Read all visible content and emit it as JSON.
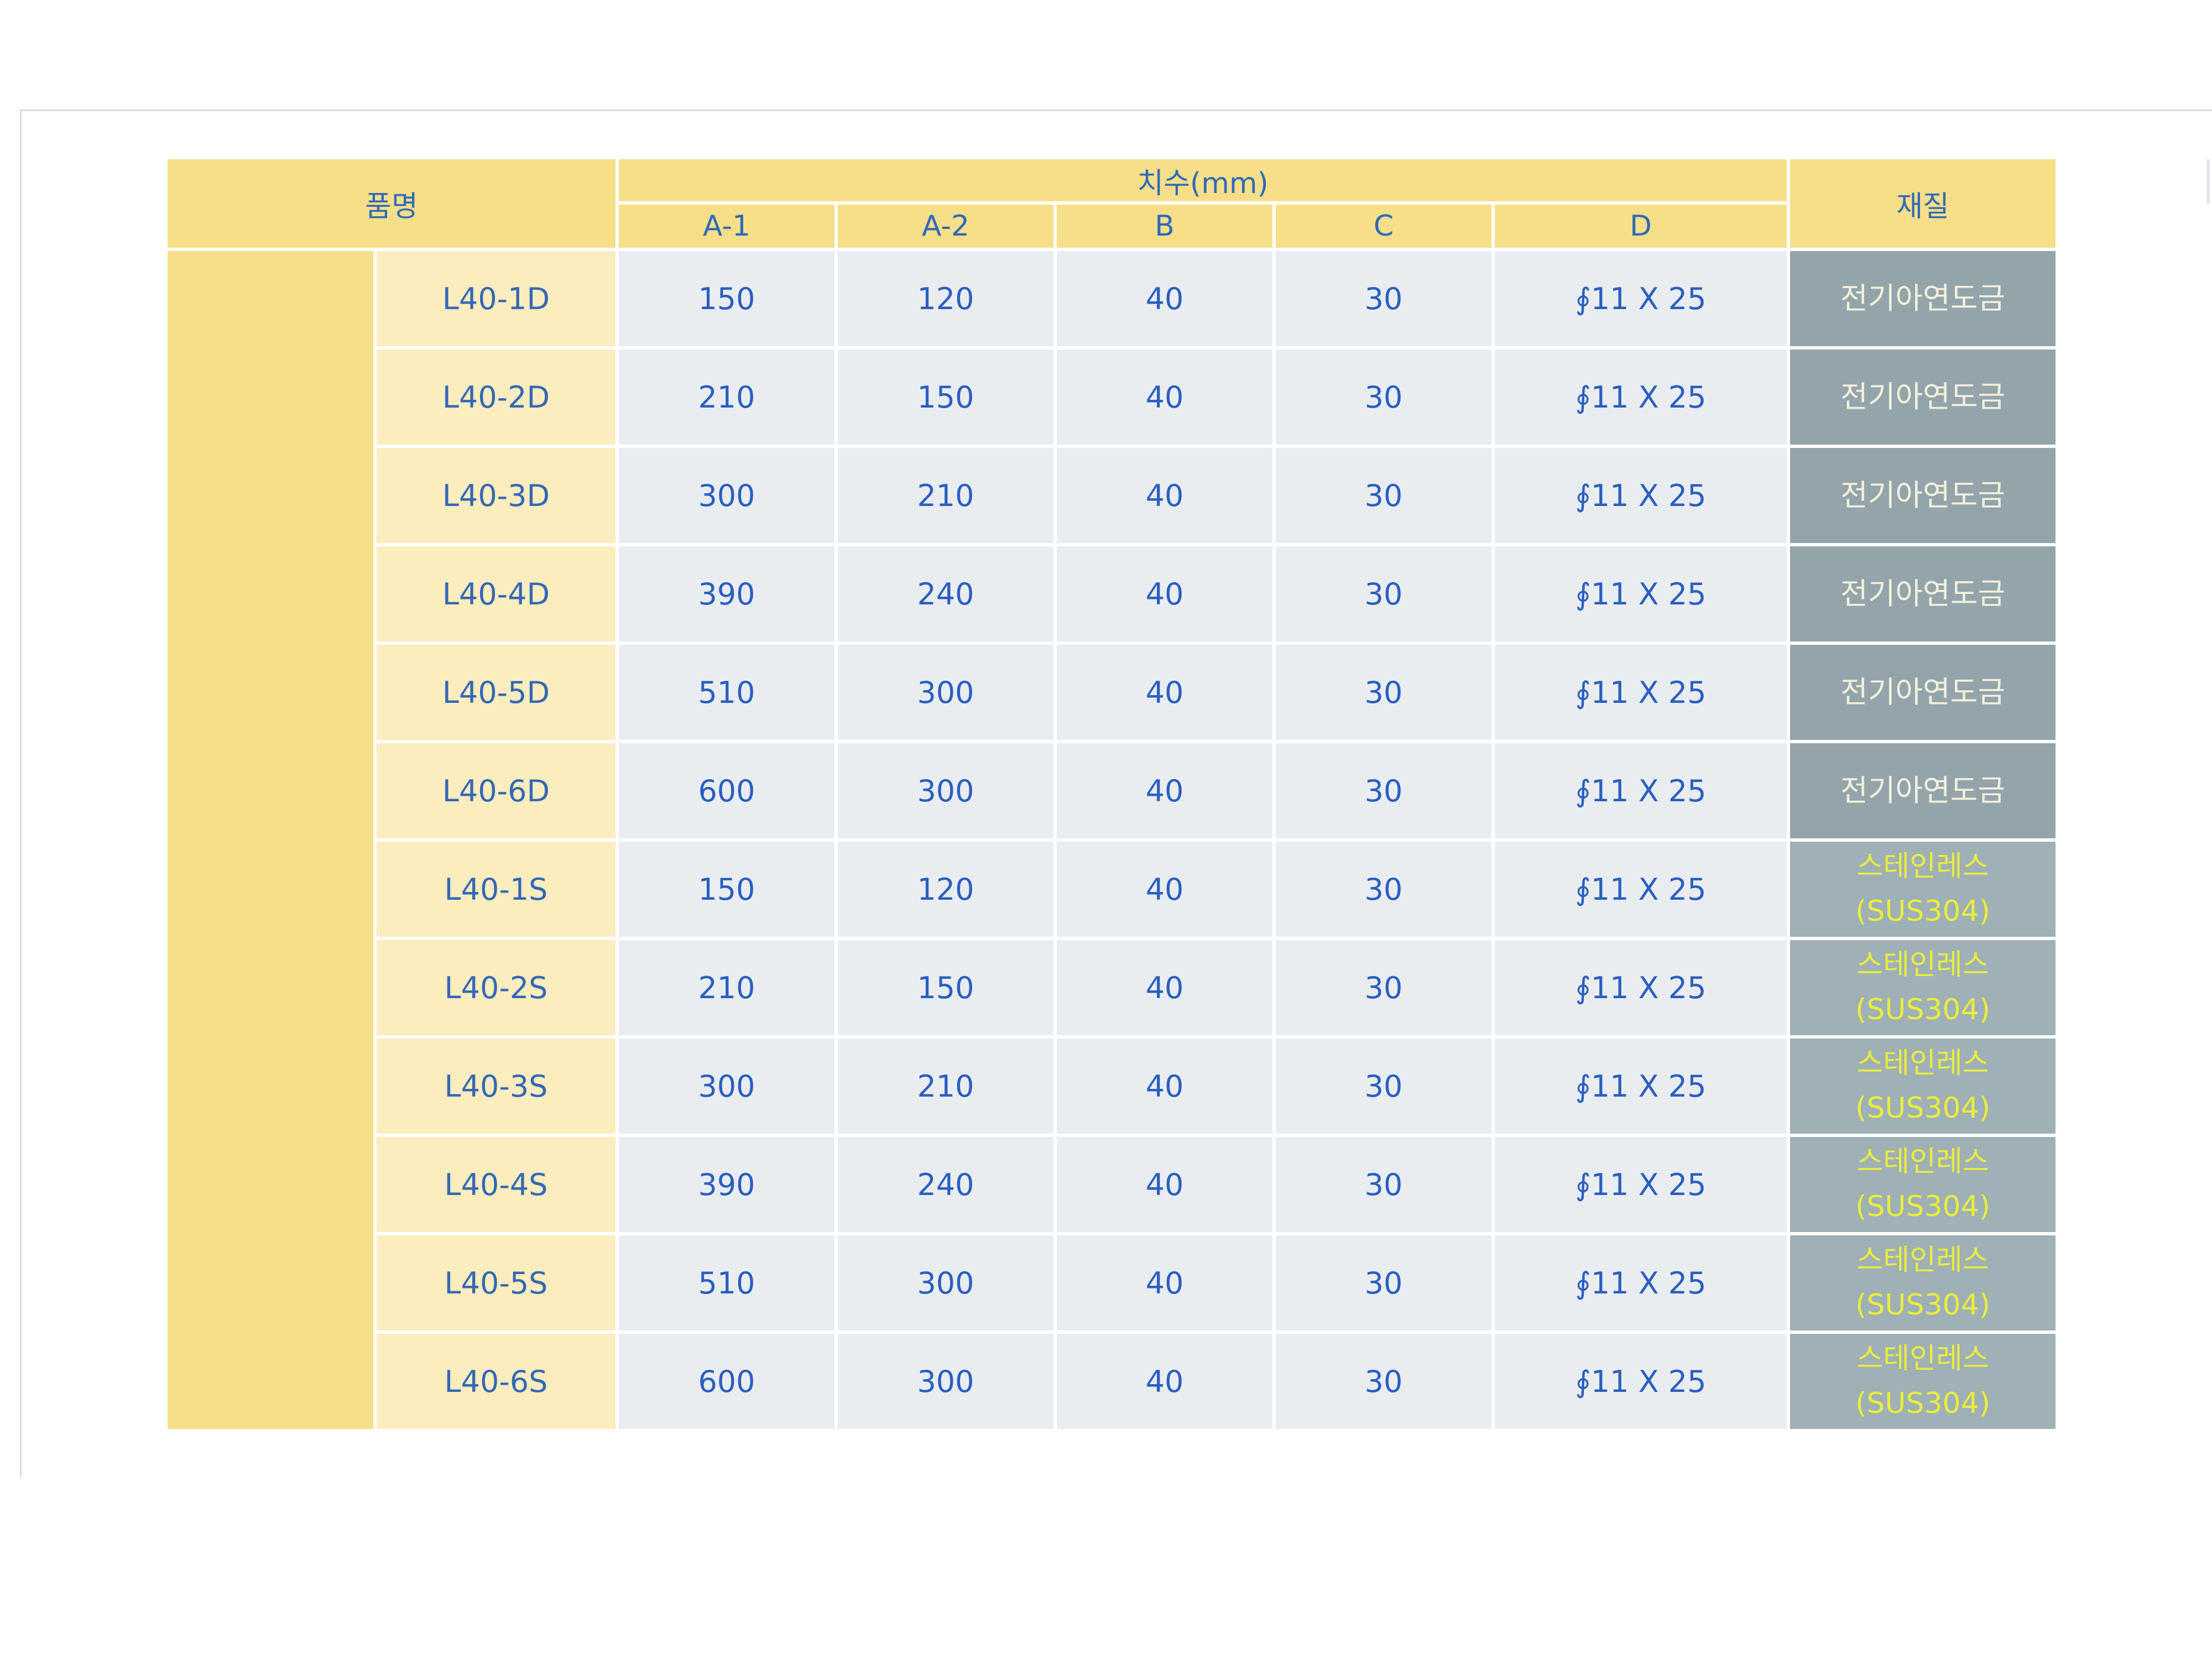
{
  "table": {
    "header": {
      "name": "품명",
      "dimensions": "치수(mm)",
      "material": "재질",
      "columns": [
        "A-1",
        "A-2",
        "B",
        "C",
        "D"
      ]
    },
    "rows": [
      {
        "name": "L40-1D",
        "a1": "150",
        "a2": "120",
        "b": "40",
        "c": "30",
        "d": "∮11 X 25",
        "material": "전기아연도금",
        "material_note": ""
      },
      {
        "name": "L40-2D",
        "a1": "210",
        "a2": "150",
        "b": "40",
        "c": "30",
        "d": "∮11 X 25",
        "material": "전기아연도금",
        "material_note": ""
      },
      {
        "name": "L40-3D",
        "a1": "300",
        "a2": "210",
        "b": "40",
        "c": "30",
        "d": "∮11 X 25",
        "material": "전기아연도금",
        "material_note": ""
      },
      {
        "name": "L40-4D",
        "a1": "390",
        "a2": "240",
        "b": "40",
        "c": "30",
        "d": "∮11 X 25",
        "material": "전기아연도금",
        "material_note": ""
      },
      {
        "name": "L40-5D",
        "a1": "510",
        "a2": "300",
        "b": "40",
        "c": "30",
        "d": "∮11 X 25",
        "material": "전기아연도금",
        "material_note": ""
      },
      {
        "name": "L40-6D",
        "a1": "600",
        "a2": "300",
        "b": "40",
        "c": "30",
        "d": "∮11 X 25",
        "material": "전기아연도금",
        "material_note": ""
      },
      {
        "name": "L40-1S",
        "a1": "150",
        "a2": "120",
        "b": "40",
        "c": "30",
        "d": "∮11 X 25",
        "material": "스테인레스",
        "material_note": "(SUS304)"
      },
      {
        "name": "L40-2S",
        "a1": "210",
        "a2": "150",
        "b": "40",
        "c": "30",
        "d": "∮11 X 25",
        "material": "스테인레스",
        "material_note": "(SUS304)"
      },
      {
        "name": "L40-3S",
        "a1": "300",
        "a2": "210",
        "b": "40",
        "c": "30",
        "d": "∮11 X 25",
        "material": "스테인레스",
        "material_note": "(SUS304)"
      },
      {
        "name": "L40-4S",
        "a1": "390",
        "a2": "240",
        "b": "40",
        "c": "30",
        "d": "∮11 X 25",
        "material": "스테인레스",
        "material_note": "(SUS304)"
      },
      {
        "name": "L40-5S",
        "a1": "510",
        "a2": "300",
        "b": "40",
        "c": "30",
        "d": "∮11 X 25",
        "material": "스테인레스",
        "material_note": "(SUS304)"
      },
      {
        "name": "L40-6S",
        "a1": "600",
        "a2": "300",
        "b": "40",
        "c": "30",
        "d": "∮11 X 25",
        "material": "스테인레스",
        "material_note": "(SUS304)"
      }
    ]
  },
  "colors": {
    "header_bg": "#f7df89",
    "name_bg": "#fbedbe",
    "value_bg": "#eaedf0",
    "material_zinc_bg": "#93a5ab",
    "material_sus_bg": "#9fb0b6",
    "text_blue": "#2a5fc0",
    "material_sus_text": "#e9ee3c"
  }
}
